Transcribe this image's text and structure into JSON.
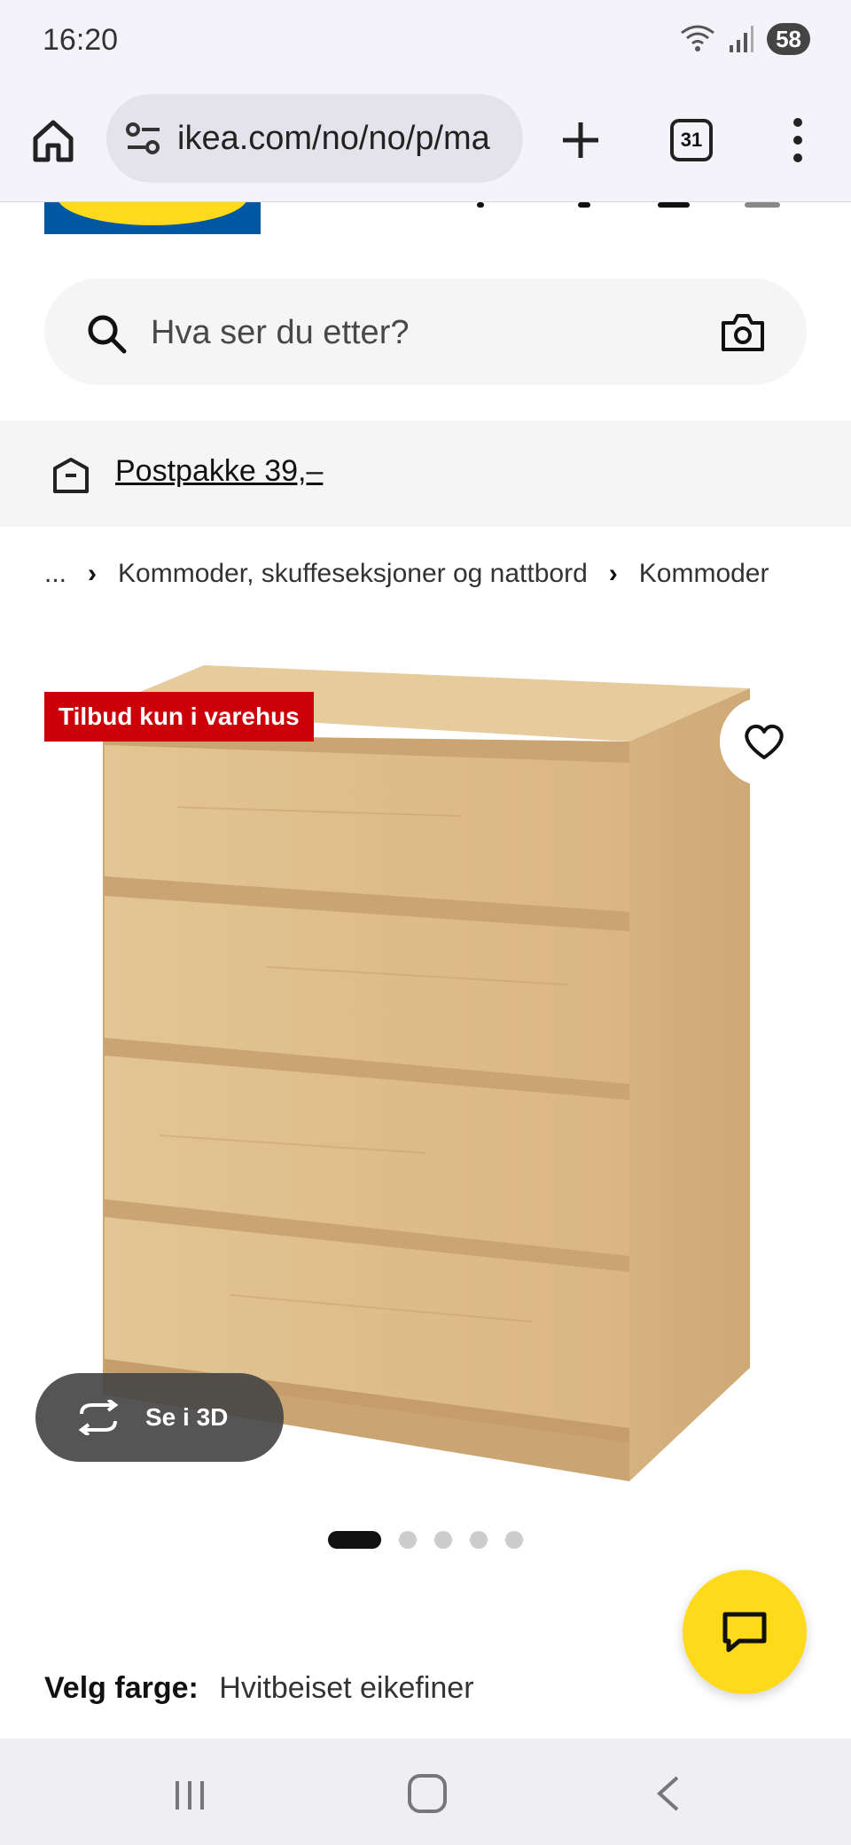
{
  "status": {
    "time": "16:20",
    "battery": "58"
  },
  "browser": {
    "url": "ikea.com/no/no/p/ma",
    "tab_count": "31"
  },
  "search": {
    "placeholder": "Hva ser du etter?"
  },
  "promo": {
    "label": "Postpakke 39,–"
  },
  "breadcrumb": {
    "items": [
      "...",
      "Kommoder, skuffeseksjoner og nattbord",
      "Kommoder"
    ]
  },
  "product": {
    "badge": "Tilbud kun i varehus",
    "view_3d_label": "Se i 3D",
    "image_count": 5,
    "active_image": 1,
    "color_label": "Velg farge:",
    "color_value": "Hvitbeiset eikefiner"
  },
  "colors": {
    "ikea_blue": "#0058a3",
    "ikea_yellow": "#ffda1a",
    "badge_red": "#cc0008"
  }
}
